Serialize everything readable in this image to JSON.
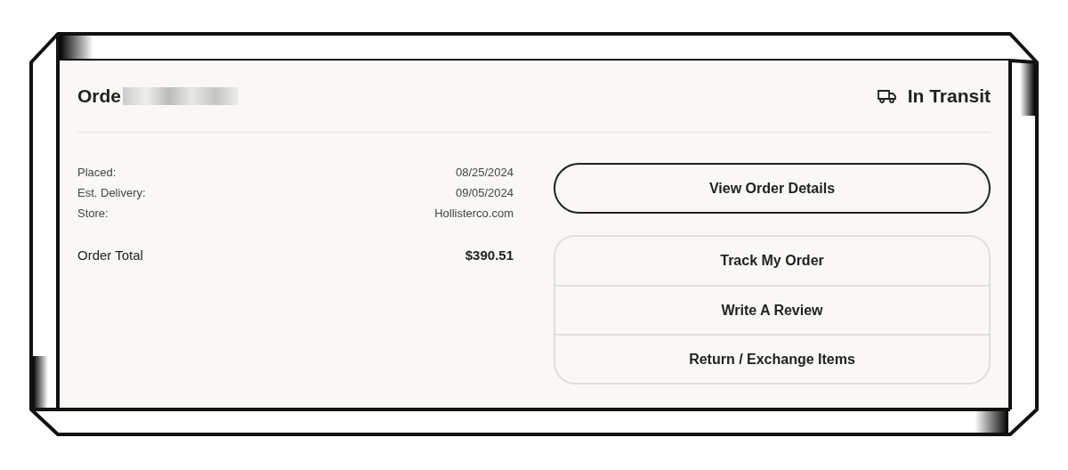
{
  "order": {
    "title": "Orde",
    "status": "In Transit"
  },
  "details": [
    {
      "label": "Placed:",
      "value": "08/25/2024"
    },
    {
      "label": "Est. Delivery:",
      "value": "09/05/2024"
    },
    {
      "label": "Store:",
      "value": "Hollisterco.com"
    }
  ],
  "total": {
    "label": "Order Total",
    "value": "$390.51"
  },
  "primary_button": "View Order Details",
  "actions": [
    "Track My Order",
    "Write A Review",
    "Return / Exchange Items"
  ]
}
